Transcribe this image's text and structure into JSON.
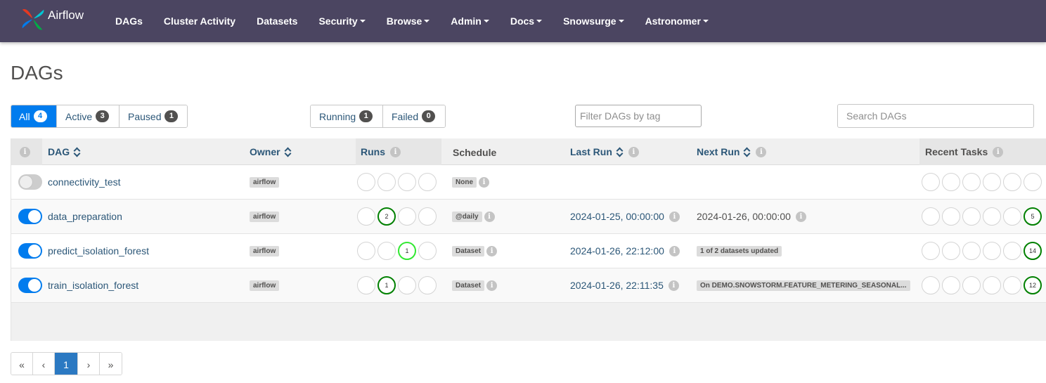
{
  "brand": {
    "name": "Airflow"
  },
  "nav": [
    {
      "label": "DAGs",
      "dropdown": false
    },
    {
      "label": "Cluster Activity",
      "dropdown": false
    },
    {
      "label": "Datasets",
      "dropdown": false
    },
    {
      "label": "Security",
      "dropdown": true
    },
    {
      "label": "Browse",
      "dropdown": true
    },
    {
      "label": "Admin",
      "dropdown": true
    },
    {
      "label": "Docs",
      "dropdown": true
    },
    {
      "label": "Snowsurge",
      "dropdown": true
    },
    {
      "label": "Astronomer",
      "dropdown": true
    }
  ],
  "page_title": "DAGs",
  "status_filter": {
    "all": {
      "label": "All",
      "count": "4"
    },
    "active": {
      "label": "Active",
      "count": "3"
    },
    "paused": {
      "label": "Paused",
      "count": "1"
    }
  },
  "run_filter": {
    "running": {
      "label": "Running",
      "count": "1"
    },
    "failed": {
      "label": "Failed",
      "count": "0"
    }
  },
  "tag_filter": {
    "placeholder": "Filter DAGs by tag"
  },
  "search": {
    "placeholder": "Search DAGs"
  },
  "columns": {
    "dag": "DAG",
    "owner": "Owner",
    "runs": "Runs",
    "schedule": "Schedule",
    "last_run": "Last Run",
    "next_run": "Next Run",
    "recent_tasks": "Recent Tasks"
  },
  "icons": {
    "info": "info-icon",
    "sort": "sort-icon",
    "toggle": "toggle-switch",
    "dropdown": "caret-down-icon"
  },
  "info_glyph": "i",
  "colors": {
    "navbar": "#4b4561",
    "accent": "#017cee",
    "link": "#2c5778",
    "success": "#008000",
    "running": "#32e832"
  },
  "dags": [
    {
      "id": "connectivity_test",
      "enabled": false,
      "owner": "airflow",
      "runs": [
        "",
        "",
        "",
        ""
      ],
      "run_states": [
        "none",
        "none",
        "none",
        "none"
      ],
      "schedule": "None",
      "last_run": "",
      "next_run": "",
      "next_run_kind": "none",
      "recent_tasks": [
        "",
        "",
        "",
        "",
        "",
        ""
      ],
      "task_states": [
        "none",
        "none",
        "none",
        "none",
        "none",
        "none"
      ]
    },
    {
      "id": "data_preparation",
      "enabled": true,
      "owner": "airflow",
      "runs": [
        "",
        "2",
        "",
        ""
      ],
      "run_states": [
        "none",
        "success",
        "none",
        "none"
      ],
      "schedule": "@daily",
      "last_run": "2024-01-25, 00:00:00",
      "next_run": "2024-01-26, 00:00:00",
      "next_run_kind": "date",
      "recent_tasks": [
        "",
        "",
        "",
        "",
        "",
        "5"
      ],
      "task_states": [
        "none",
        "none",
        "none",
        "none",
        "none",
        "success"
      ]
    },
    {
      "id": "predict_isolation_forest",
      "enabled": true,
      "owner": "airflow",
      "runs": [
        "",
        "",
        "1",
        ""
      ],
      "run_states": [
        "none",
        "none",
        "running",
        "none"
      ],
      "schedule": "Dataset",
      "last_run": "2024-01-26, 22:12:00",
      "next_run": "1 of 2 datasets updated",
      "next_run_kind": "tag",
      "recent_tasks": [
        "",
        "",
        "",
        "",
        "",
        "14"
      ],
      "task_states": [
        "none",
        "none",
        "none",
        "none",
        "none",
        "success"
      ]
    },
    {
      "id": "train_isolation_forest",
      "enabled": true,
      "owner": "airflow",
      "runs": [
        "",
        "1",
        "",
        ""
      ],
      "run_states": [
        "none",
        "success",
        "none",
        "none"
      ],
      "schedule": "Dataset",
      "last_run": "2024-01-26, 22:11:35",
      "next_run": "On DEMO.SNOWSTORM.FEATURE_METERING_SEASONAL...",
      "next_run_kind": "tag",
      "recent_tasks": [
        "",
        "",
        "",
        "",
        "",
        "12"
      ],
      "task_states": [
        "none",
        "none",
        "none",
        "none",
        "none",
        "success"
      ]
    }
  ],
  "pagination": {
    "first": "«",
    "prev": "‹",
    "current": "1",
    "next": "›",
    "last": "»"
  }
}
